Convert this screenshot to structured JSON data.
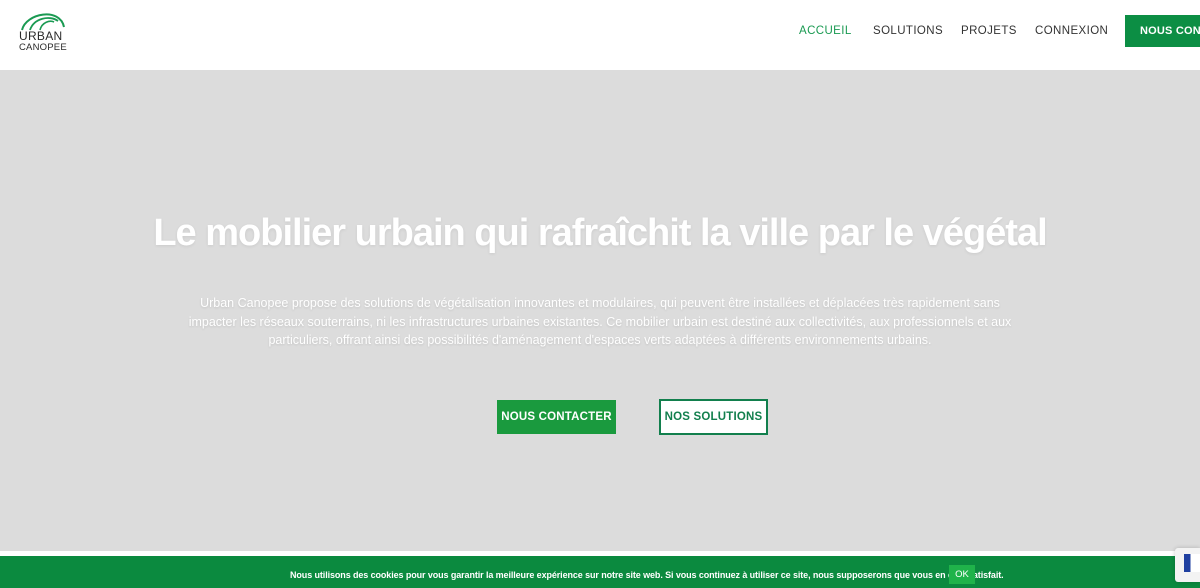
{
  "brand": {
    "line1": "URBAN",
    "line2": "CANOPEE",
    "accent": "#1a9a52"
  },
  "nav": {
    "items": [
      {
        "label": "ACCUEIL",
        "active": true
      },
      {
        "label": "SOLUTIONS",
        "active": false
      },
      {
        "label": "PROJETS",
        "active": false
      },
      {
        "label": "CONNEXION",
        "active": false
      }
    ],
    "cta_label": "NOUS CONTACTER"
  },
  "hero": {
    "title": "Le mobilier urbain qui rafraîchit la ville par le végétal",
    "description": "Urban Canopee propose des solutions de végétalisation innovantes et modulaires, qui peuvent être installées et déplacées très rapidement sans impacter les réseaux souterrains, ni les infrastructures urbaines existantes. Ce mobilier urbain est destiné aux collectivités, aux professionnels et aux particuliers, offrant ainsi des possibilités d'aménagement d'espaces verts adaptées à différents environnements urbains.",
    "primary_button": "NOUS CONTACTER",
    "secondary_button": "NOS SOLUTIONS",
    "background": "#dcdcdc"
  },
  "cookie": {
    "text": "Nous utilisons des cookies pour vous garantir la meilleure expérience sur notre site web. Si vous continuez à utiliser ce site, nous supposerons que vous en êtes satisfait.",
    "ok_label": "OK",
    "background": "#0b8a3f"
  },
  "icons": {
    "logo": "canopy-arc-logo",
    "side_widget": "flag-icon"
  }
}
